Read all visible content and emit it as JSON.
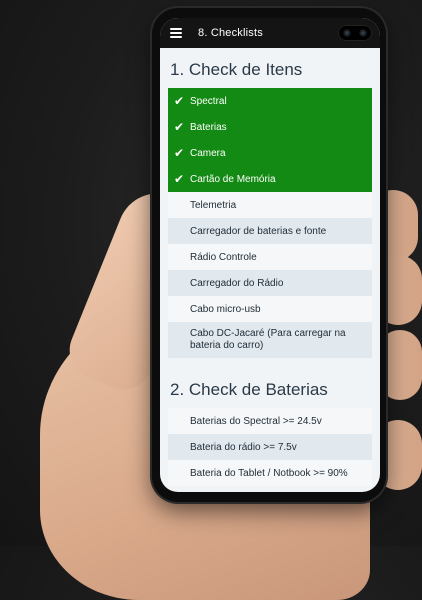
{
  "app": {
    "title": "8. Checklists"
  },
  "section1": {
    "title": "1. Check de Itens",
    "items": [
      {
        "label": "Spectral",
        "checked": true
      },
      {
        "label": "Baterias",
        "checked": true
      },
      {
        "label": "Camera",
        "checked": true
      },
      {
        "label": "Cartão de Memória",
        "checked": true
      },
      {
        "label": "Telemetria",
        "checked": false
      },
      {
        "label": "Carregador de baterias e fonte",
        "checked": false
      },
      {
        "label": "Rádio Controle",
        "checked": false
      },
      {
        "label": "Carregador do Rádio",
        "checked": false
      },
      {
        "label": "Cabo micro-usb",
        "checked": false
      },
      {
        "label": "Cabo DC-Jacaré (Para carregar na bateria do carro)",
        "checked": false
      }
    ]
  },
  "section2": {
    "title": "2. Check de Baterias",
    "items": [
      {
        "label": "Baterias do Spectral >= 24.5v",
        "checked": false
      },
      {
        "label": "Bateria do rádio >= 7.5v",
        "checked": false
      },
      {
        "label": "Bateria do Tablet / Notbook >= 90%",
        "checked": false
      }
    ]
  },
  "icons": {
    "menu": "hamburger-menu-icon",
    "check": "check-icon"
  },
  "colors": {
    "checked": "#138a13",
    "appbar": "#141414"
  }
}
